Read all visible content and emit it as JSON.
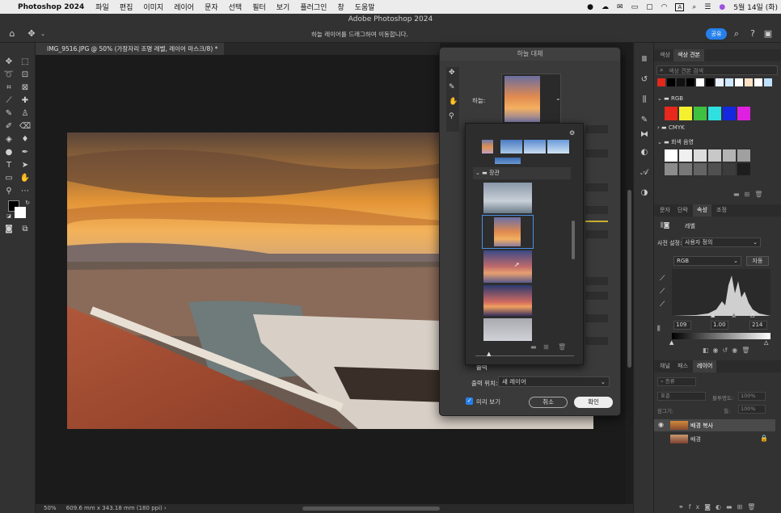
{
  "menubar": {
    "app": "Photoshop 2024",
    "items": [
      "파일",
      "편집",
      "이미지",
      "레이어",
      "문자",
      "선택",
      "필터",
      "보기",
      "플러그인",
      "창",
      "도움말"
    ],
    "date": "5월 14일 (화)"
  },
  "window": {
    "title": "Adobe Photoshop 2024"
  },
  "options": {
    "hint": "하늘 레이어를 드래그하여 이동합니다.",
    "share": "공유"
  },
  "document": {
    "tab": "IMG_9516.JPG @ 50% (가장자리 조명 레벨, 레이어 마스크/8) *",
    "zoom": "50%",
    "info": "609.6 mm x 343.18 mm (180 ppi)"
  },
  "dialog": {
    "title": "하늘 대체",
    "sky_label": "하늘:",
    "folder": "장관",
    "output_section": "출력",
    "output_to_label": "출력 위치:",
    "output_to_value": "새 레이어",
    "preview_label": "미리 보기",
    "preview_checked": true,
    "cancel": "취소",
    "ok": "확인"
  },
  "swatches_panel": {
    "tabs": [
      "색상",
      "색상 견본"
    ],
    "search_placeholder": "색상 견본 검색",
    "row_colors": [
      "#e0281c",
      "#000000",
      "#111111",
      "#000000",
      "#ffffff",
      "#000000",
      "#e8f0ff",
      "#cde8ff",
      "#ffffff",
      "#fbe2c4",
      "#ffffff",
      "#bfe0ff"
    ],
    "group_rgb": "RGB",
    "rgb_colors": [
      "#e8281c",
      "#f4f030",
      "#40c040",
      "#30e0e0",
      "#1428e0",
      "#e020e0"
    ],
    "group_cmyk": "CMYK",
    "group_gray": "회색 음영",
    "gray_colors": [
      "#ffffff",
      "#f0f0f0",
      "#dcdcdc",
      "#c8c8c8",
      "#b4b4b4",
      "#a0a0a0",
      "#8c8c8c",
      "#787878",
      "#646464",
      "#505050",
      "#3c3c3c",
      "#1e1e1e"
    ]
  },
  "properties_panel": {
    "tabs": [
      "문자",
      "단락",
      "속성",
      "조정"
    ],
    "active_tab": "속성",
    "layer_type": "레벨",
    "preset_label": "사전 설정:",
    "preset_value": "사용자 정의",
    "channel": "RGB",
    "auto": "자동",
    "input_black": "109",
    "input_gamma": "1.00",
    "input_white": "214",
    "output_black": "0",
    "output_white": "255"
  },
  "layers_panel": {
    "tabs": [
      "채널",
      "패스",
      "레이어"
    ],
    "active_tab": "레이어",
    "kind_label": "종류",
    "blend_mode": "표준",
    "opacity_label": "불투명도:",
    "opacity": "100%",
    "lock_label": "잠그기:",
    "fill_label": "칠:",
    "fill": "100%",
    "layers": [
      {
        "name": "배경 복사",
        "visible": true,
        "selected": true
      },
      {
        "name": "배경",
        "visible": false,
        "locked": true
      }
    ]
  }
}
